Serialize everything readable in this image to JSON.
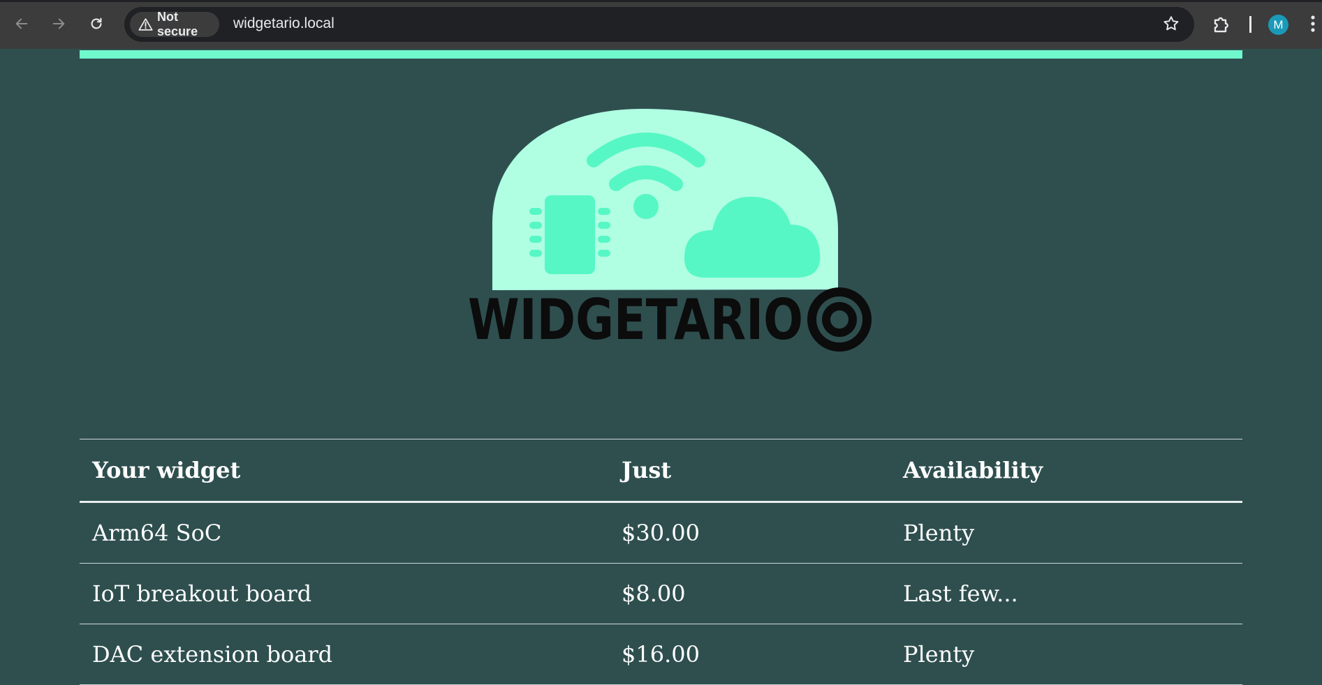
{
  "browser": {
    "security_label": "Not secure",
    "url": "widgetario.local",
    "profile_initial": "M"
  },
  "brand": {
    "name": "WIDGETARIO",
    "accent_color": "#70f9cd",
    "background_color": "#2f4f4f"
  },
  "table": {
    "headers": [
      "Your widget",
      "Just",
      "Availability"
    ],
    "rows": [
      {
        "name": "Arm64 SoC",
        "price": "$30.00",
        "availability": "Plenty"
      },
      {
        "name": "IoT breakout board",
        "price": "$8.00",
        "availability": "Last few..."
      },
      {
        "name": "DAC extension board",
        "price": "$16.00",
        "availability": "Plenty"
      }
    ]
  }
}
